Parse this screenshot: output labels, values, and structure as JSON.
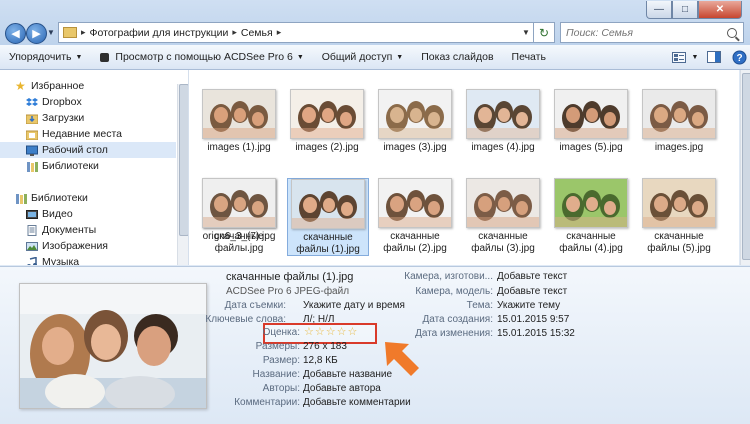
{
  "address": {
    "crumbs": [
      "Фотографии для инструкции",
      "Семья"
    ],
    "search_placeholder": "Поиск: Семья"
  },
  "toolbar": {
    "organize": "Упорядочить",
    "acdsee": "Просмотр с помощью ACDSee Pro 6",
    "share": "Общий доступ",
    "slideshow": "Показ слайдов",
    "print": "Печать"
  },
  "nav": {
    "favorites": "Избранное",
    "dropbox": "Dropbox",
    "downloads": "Загрузки",
    "recent": "Недавние места",
    "desktop": "Рабочий стол",
    "libraries_fav": "Библиотеки",
    "libraries": "Библиотеки",
    "video": "Видео",
    "documents": "Документы",
    "images": "Изображения",
    "music": "Музыка"
  },
  "files": [
    {
      "name": "images (1).jpg",
      "palette": [
        "#7a5a40",
        "#d9a07b",
        "#e9e4dc"
      ]
    },
    {
      "name": "images (2).jpg",
      "palette": [
        "#6a4c35",
        "#e0a684",
        "#f4efe8"
      ]
    },
    {
      "name": "images (3).jpg",
      "palette": [
        "#8b6b4a",
        "#d8b48f",
        "#f2f2f2"
      ]
    },
    {
      "name": "images (4).jpg",
      "palette": [
        "#5a4634",
        "#e2b596",
        "#dfe9f3"
      ]
    },
    {
      "name": "images (5).jpg",
      "palette": [
        "#4e3b2c",
        "#d39b78",
        "#f0f0f0"
      ]
    },
    {
      "name": "images.jpg",
      "palette": [
        "#7b5b45",
        "#dba983",
        "#eaeaea"
      ]
    },
    {
      "name": "orign6_3_(7).jpg",
      "palette": [
        "#6b4a36",
        "#d19a76",
        "#7aa0c8"
      ]
    },
    {
      "name": "скачанные файлы (1).jpg",
      "palette": [
        "#5d4431",
        "#e0ab88",
        "#d8e4ee"
      ]
    },
    {
      "name": "скачанные файлы (2).jpg",
      "palette": [
        "#6e523c",
        "#d9a381",
        "#f2f2f2"
      ]
    },
    {
      "name": "скачанные файлы (3).jpg",
      "palette": [
        "#7c5c46",
        "#d6a07d",
        "#ece8e4"
      ]
    },
    {
      "name": "скачанные файлы (4).jpg",
      "palette": [
        "#4a6a2e",
        "#e0ad8c",
        "#9bc66a"
      ]
    },
    {
      "name": "скачанные файлы (5).jpg",
      "palette": [
        "#6a5038",
        "#dcaa88",
        "#e8d8c0"
      ]
    },
    {
      "name": "скачанные файлы.jpg",
      "palette": [
        "#6e5541",
        "#d8a582",
        "#efefef"
      ]
    }
  ],
  "details": {
    "title": "скачанные файлы (1).jpg",
    "type": "ACDSee Pro 6 JPEG-файл",
    "k_date_taken": "Дата съемки:",
    "v_date_taken": "Укажите дату и время",
    "k_keywords": "Ключевые слова:",
    "v_keywords": "Л/; Н/Л",
    "k_rating": "Оценка:",
    "rating": 0,
    "k_dimensions": "Размеры:",
    "v_dimensions": "276 x 183",
    "k_size": "Размер:",
    "v_size": "12,8 КБ",
    "k_name": "Название:",
    "v_name": "Добавьте название",
    "k_authors": "Авторы:",
    "v_authors": "Добавьте автора",
    "k_comments": "Комментарии:",
    "v_comments": "Добавьте комментарии",
    "k_cam_maker": "Камера, изготови...",
    "v_cam_maker": "Добавьте текст",
    "k_cam_model": "Камера, модель:",
    "v_cam_model": "Добавьте текст",
    "k_subject": "Тема:",
    "v_subject": "Укажите тему",
    "k_created": "Дата создания:",
    "v_created": "15.01.2015 9:57",
    "k_modified": "Дата изменения:",
    "v_modified": "15.01.2015 15:32"
  },
  "colors": {
    "accent_selection": "#cde4fb",
    "annotation": "#d93a2a",
    "arrow": "#f07a2a"
  }
}
